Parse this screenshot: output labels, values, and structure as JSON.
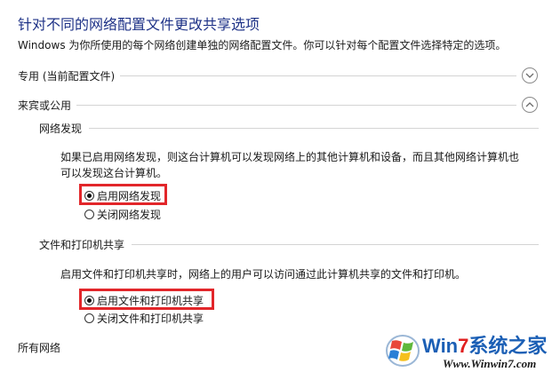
{
  "page": {
    "title": "针对不同的网络配置文件更改共享选项",
    "description": "Windows 为你所使用的每个网络创建单独的网络配置文件。你可以针对每个配置文件选择特定的选项。"
  },
  "sections": {
    "private": {
      "label": "专用 (当前配置文件)",
      "expanded": false
    },
    "guest_public": {
      "label": "来宾或公用",
      "expanded": true
    },
    "all_networks": {
      "label": "所有网络"
    }
  },
  "network_discovery": {
    "heading": "网络发现",
    "description_line1": "如果已启用网络发现，则这台计算机可以发现网络上的其他计算机和设备，而且其他网络计算机也",
    "description_line2": "可以发现这台计算机。",
    "options": [
      {
        "label": "启用网络发现",
        "checked": true
      },
      {
        "label": "关闭网络发现",
        "checked": false
      }
    ]
  },
  "file_printer_sharing": {
    "heading": "文件和打印机共享",
    "description": "启用文件和打印机共享时，网络上的用户可以访问通过此计算机共享的文件和打印机。",
    "options": [
      {
        "label": "启用文件和打印机共享",
        "checked": true
      },
      {
        "label": "关闭文件和打印机共享",
        "checked": false
      }
    ]
  },
  "watermark": {
    "brand_win": "Win",
    "brand_7": "7",
    "brand_rest": "系统之家",
    "url": "Www.Winwin7.com"
  },
  "colors": {
    "title_blue": "#1e3287",
    "highlight_red": "#e2262a",
    "divider": "#d4d4d4",
    "watermark_blue": "#1b5fb5",
    "watermark_red": "#e02020"
  }
}
